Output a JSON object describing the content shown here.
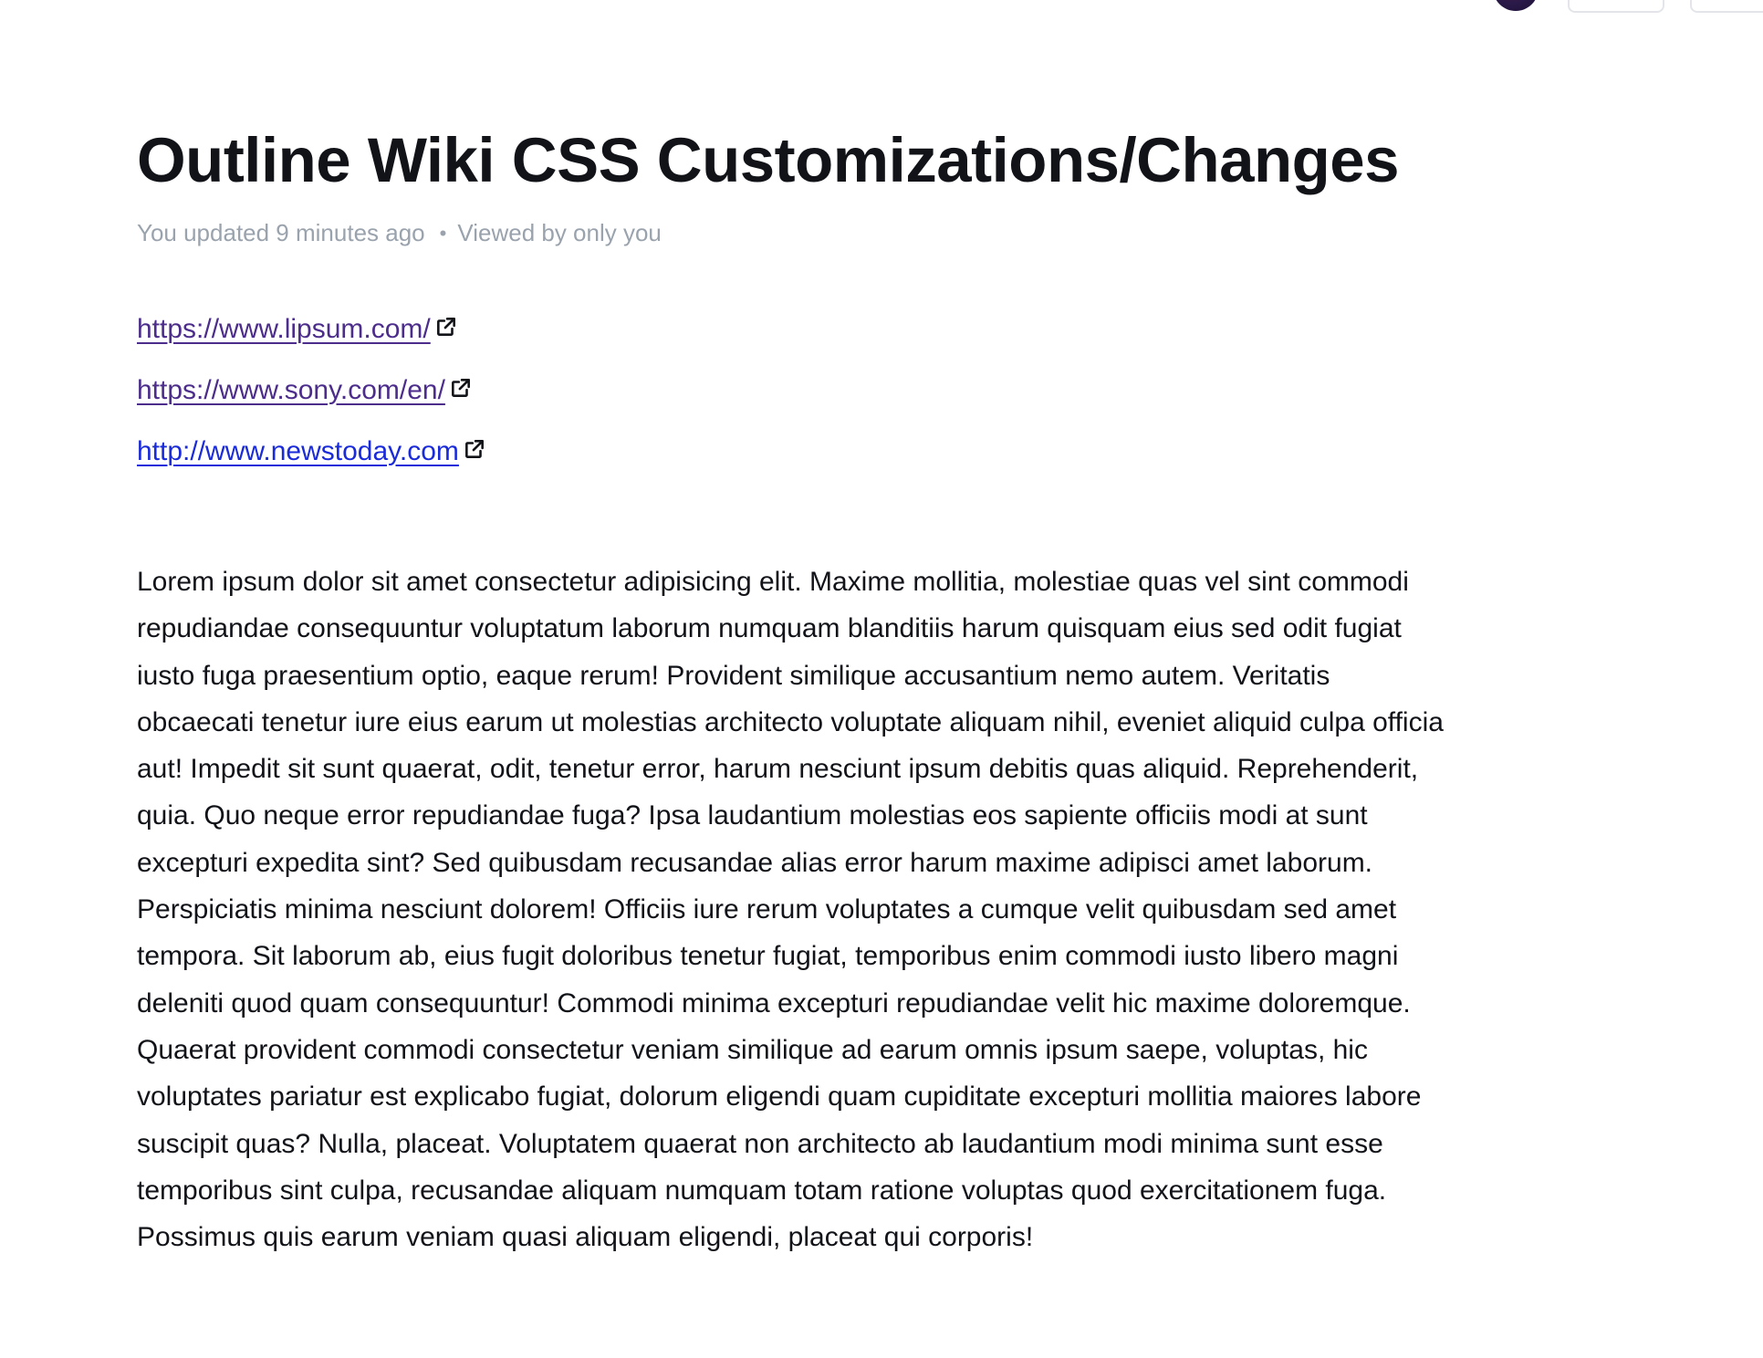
{
  "toolbar": {
    "avatar_icon": "avatar",
    "button_1_icon": "button",
    "button_2_icon": "button"
  },
  "document": {
    "title": "Outline Wiki CSS Customizations/Changes",
    "meta": {
      "updated": "You updated 9 minutes ago",
      "separator": "•",
      "viewed": "Viewed by only you"
    },
    "links": [
      {
        "text": "https://www.lipsum.com/",
        "state": "visited",
        "icon": "external-link-icon"
      },
      {
        "text": "https://www.sony.com/en/",
        "state": "visited",
        "icon": "external-link-icon"
      },
      {
        "text": "http://www.newstoday.com",
        "state": "unvisited",
        "icon": "external-link-icon"
      }
    ],
    "paragraph": "Lorem ipsum dolor sit amet consectetur adipisicing elit. Maxime mollitia, molestiae quas vel sint commodi repudiandae consequuntur voluptatum laborum numquam blanditiis harum quisquam eius sed odit fugiat iusto fuga praesentium optio, eaque rerum! Provident similique accusantium nemo autem. Veritatis obcaecati tenetur iure eius earum ut molestias architecto voluptate aliquam nihil, eveniet aliquid culpa officia aut! Impedit sit sunt quaerat, odit, tenetur error, harum nesciunt ipsum debitis quas aliquid. Reprehenderit, quia. Quo neque error repudiandae fuga? Ipsa laudantium molestias eos sapiente officiis modi at sunt excepturi expedita sint? Sed quibusdam recusandae alias error harum maxime adipisci amet laborum. Perspiciatis minima nesciunt dolorem! Officiis iure rerum voluptates a cumque velit quibusdam sed amet tempora. Sit laborum ab, eius fugit doloribus tenetur fugiat, temporibus enim commodi iusto libero magni deleniti quod quam consequuntur! Commodi minima excepturi repudiandae velit hic maxime doloremque. Quaerat provident commodi consectetur veniam similique ad earum omnis ipsum saepe, voluptas, hic voluptates pariatur est explicabo fugiat, dolorum eligendi quam cupiditate excepturi mollitia maiores labore suscipit quas? Nulla, placeat. Voluptatem quaerat non architecto ab laudantium modi minima sunt esse temporibus sint culpa, recusandae aliquam numquam totam ratione voluptas quod exercitationem fuga. Possimus quis earum veniam quasi aliquam eligendi, placeat qui corporis!"
  },
  "colors": {
    "text": "#111319",
    "meta": "#9aa3ad",
    "link_visited": "#4c2d8c",
    "link_unvisited": "#1a2bd9"
  }
}
